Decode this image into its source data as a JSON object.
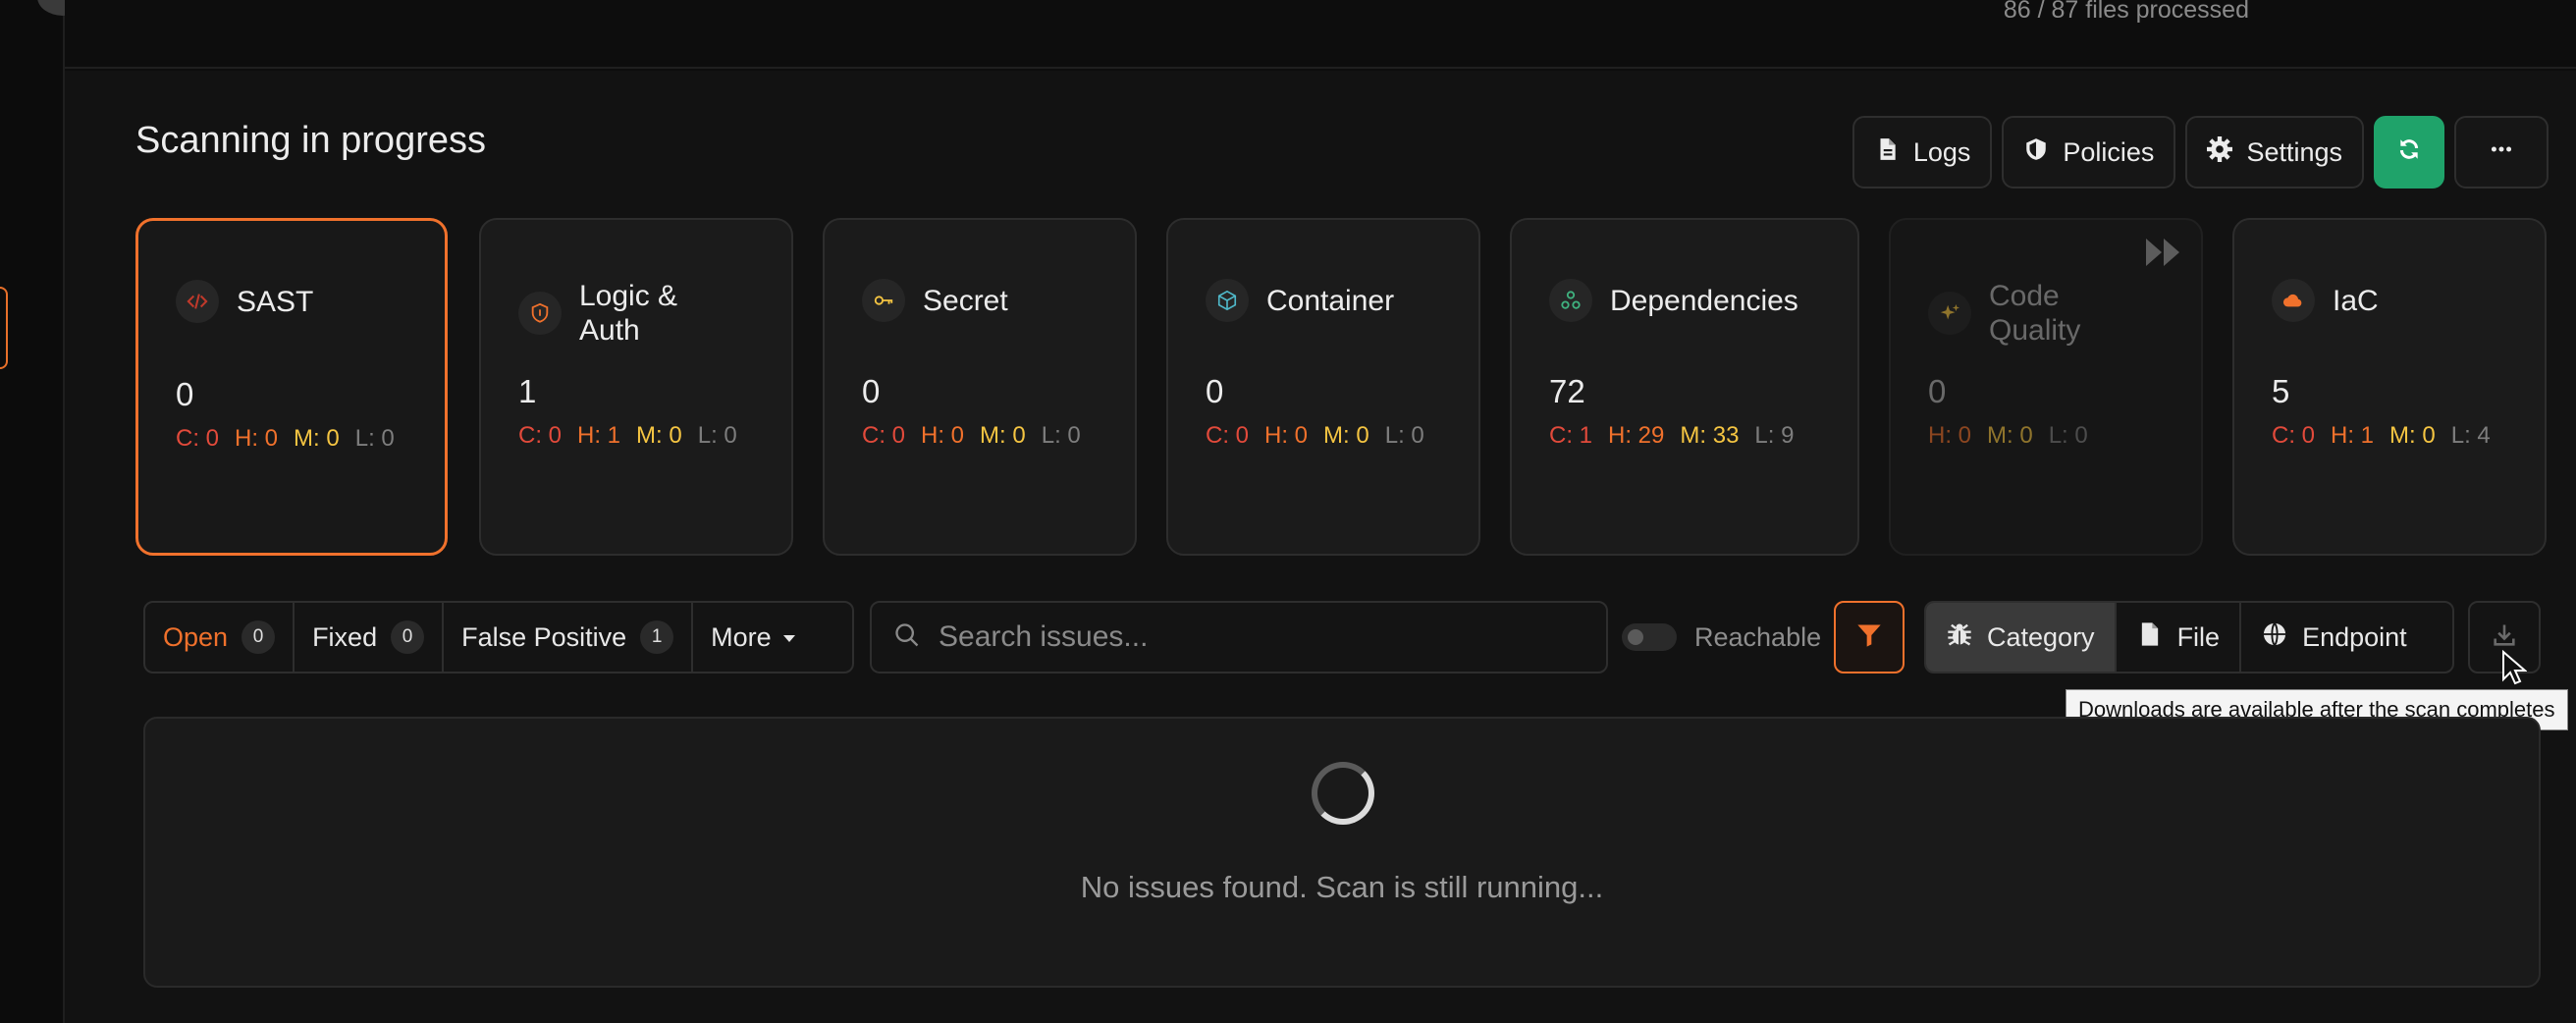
{
  "header": {
    "files_processed": "86 / 87 files processed"
  },
  "page": {
    "title": "Scanning in progress"
  },
  "actions": {
    "logs": "Logs",
    "policies": "Policies",
    "settings": "Settings"
  },
  "cards": [
    {
      "title": "SAST",
      "count": "0",
      "c": "C: 0",
      "h": "H: 0",
      "m": "M: 0",
      "l": "L: 0",
      "icon": "code-icon"
    },
    {
      "title": "Logic & Auth",
      "count": "1",
      "c": "C: 0",
      "h": "H: 1",
      "m": "M: 0",
      "l": "L: 0",
      "icon": "shield-icon"
    },
    {
      "title": "Secret",
      "count": "0",
      "c": "C: 0",
      "h": "H: 0",
      "m": "M: 0",
      "l": "L: 0",
      "icon": "key-icon"
    },
    {
      "title": "Container",
      "count": "0",
      "c": "C: 0",
      "h": "H: 0",
      "m": "M: 0",
      "l": "L: 0",
      "icon": "cube-icon"
    },
    {
      "title": "Dependencies",
      "count": "72",
      "c": "C: 1",
      "h": "H: 29",
      "m": "M: 33",
      "l": "L: 9",
      "icon": "nodes-icon"
    },
    {
      "title": "Code Quality",
      "count": "0",
      "h": "H: 0",
      "m": "M: 0",
      "l": "L: 0",
      "icon": "sparkle-icon"
    },
    {
      "title": "IaC",
      "count": "5",
      "c": "C: 0",
      "h": "H: 1",
      "m": "M: 0",
      "l": "L: 4",
      "icon": "cloud-icon"
    }
  ],
  "filters": {
    "open": "Open",
    "open_count": "0",
    "fixed": "Fixed",
    "fixed_count": "0",
    "false_positive": "False Positive",
    "false_positive_count": "1",
    "more": "More",
    "search_placeholder": "Search issues...",
    "reachable": "Reachable",
    "group_category": "Category",
    "group_file": "File",
    "group_endpoint": "Endpoint"
  },
  "tooltip": "Downloads are available after the scan completes",
  "results": {
    "empty": "No issues found. Scan is still running..."
  },
  "colors": {
    "accent": "#f0712c",
    "refresh": "#1fa36a",
    "critical": "#e24a3b",
    "high": "#f0712c",
    "medium": "#f5c542",
    "low": "#7d7d7d"
  }
}
